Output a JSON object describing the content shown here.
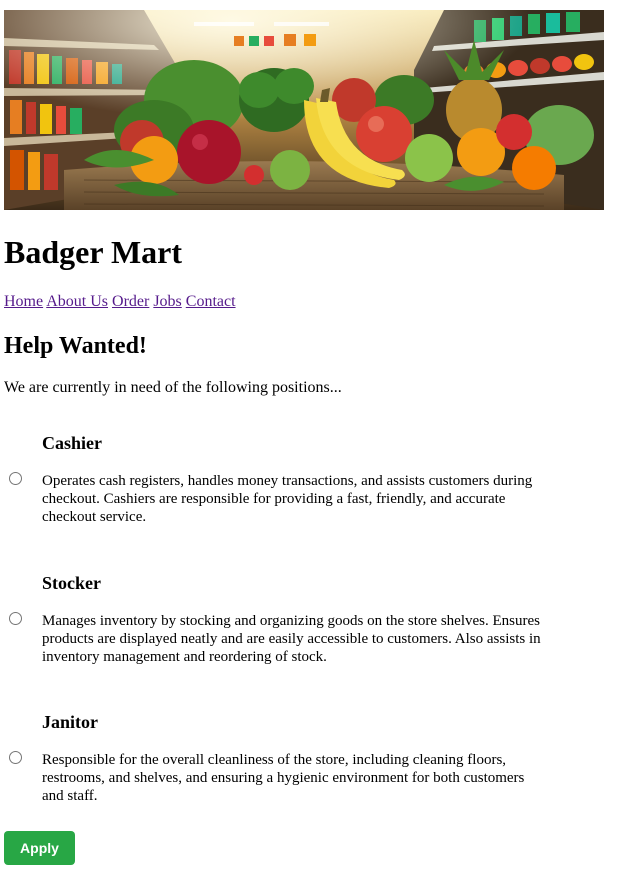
{
  "site": {
    "title": "Badger Mart"
  },
  "nav": {
    "items": [
      "Home",
      "About Us",
      "Order",
      "Jobs",
      "Contact"
    ]
  },
  "main": {
    "heading": "Help Wanted!",
    "intro": "We are currently in need of the following positions...",
    "jobs": [
      {
        "title": "Cashier",
        "description": "Operates cash registers, handles money transactions, and assists customers during checkout. Cashiers are responsible for providing a fast, friendly, and accurate checkout service.",
        "selected": false
      },
      {
        "title": "Stocker",
        "description": "Manages inventory by stocking and organizing goods on the store shelves. Ensures products are displayed neatly and are easily accessible to customers. Also assists in inventory management and reordering of stock.",
        "selected": false
      },
      {
        "title": "Janitor",
        "description": "Responsible for the overall cleanliness of the store, including cleaning floors, restrooms, and shelves, and ensuring a hygienic environment for both customers and staff.",
        "selected": false
      }
    ],
    "apply_label": "Apply"
  },
  "colors": {
    "link": "#551a8b",
    "apply_button": "#28a745",
    "apply_text": "#ffffff"
  }
}
